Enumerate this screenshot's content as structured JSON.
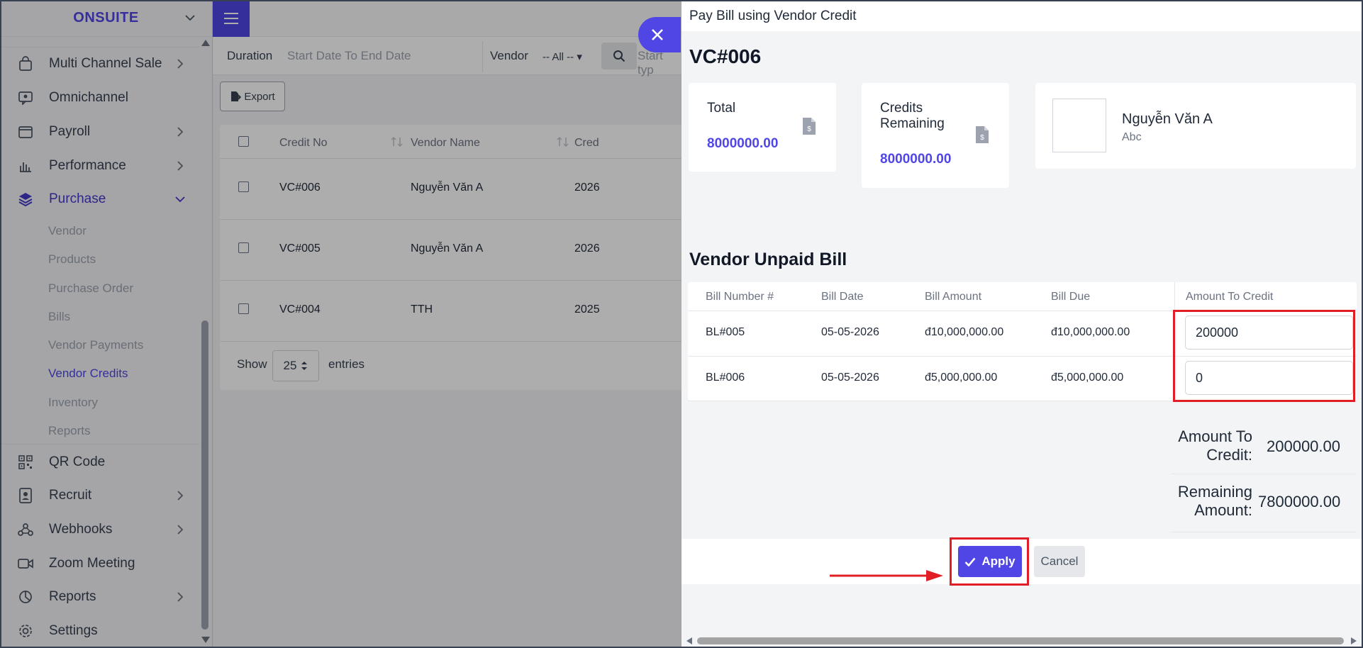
{
  "sidebar": {
    "brand": "ONSUITE",
    "items": [
      {
        "label": "Multi Channel Sale",
        "icon": "shopping-bag-icon"
      },
      {
        "label": "Omnichannel",
        "icon": "chat-icon"
      },
      {
        "label": "Payroll",
        "icon": "wallet-icon"
      },
      {
        "label": "Performance",
        "icon": "bar-chart-icon"
      },
      {
        "label": "Purchase",
        "icon": "layers-icon"
      },
      {
        "label": "QR Code",
        "icon": "qr-code-icon"
      },
      {
        "label": "Recruit",
        "icon": "id-badge-icon"
      },
      {
        "label": "Webhooks",
        "icon": "webhook-icon"
      },
      {
        "label": "Zoom Meeting",
        "icon": "video-icon"
      },
      {
        "label": "Reports",
        "icon": "pie-chart-icon"
      },
      {
        "label": "Settings",
        "icon": "gear-icon"
      }
    ],
    "purchase_sub": [
      "Vendor",
      "Products",
      "Purchase Order",
      "Bills",
      "Vendor Payments",
      "Vendor Credits",
      "Inventory",
      "Reports"
    ],
    "active_sub": "Vendor Credits"
  },
  "filters": {
    "duration_label": "Duration",
    "duration_value": "Start Date To End Date",
    "vendor_label": "Vendor",
    "vendor_value": "-- All --",
    "search_placeholder": "Start typ"
  },
  "toolbar": {
    "export_label": "Export"
  },
  "credits_table": {
    "headers": [
      "Credit No",
      "Vendor Name",
      "Cred"
    ],
    "rows": [
      {
        "credit_no": "VC#006",
        "vendor": "Nguyễn Văn A",
        "date": "2026"
      },
      {
        "credit_no": "VC#005",
        "vendor": "Nguyễn Văn A",
        "date": "2026"
      },
      {
        "credit_no": "VC#004",
        "vendor": "TTH",
        "date": "2025"
      }
    ],
    "show_label": "Show",
    "page_size": "25",
    "entries_label": "entries"
  },
  "drawer": {
    "title": "Pay Bill using Vendor Credit",
    "credit_no": "VC#006",
    "total_label": "Total",
    "total_value": "8000000.00",
    "credits_remaining_label_1": "Credits",
    "credits_remaining_label_2": "Remaining",
    "credits_remaining_value": "8000000.00",
    "vendor_name": "Nguyễn Văn A",
    "vendor_company": "Abc",
    "section_title": "Vendor Unpaid Bill",
    "bill_headers": [
      "Bill Number #",
      "Bill Date",
      "Bill Amount",
      "Bill Due",
      "Amount To Credit"
    ],
    "bills": [
      {
        "number": "BL#005",
        "date": "05-05-2026",
        "amount": "đ10,000,000.00",
        "due": "đ10,000,000.00",
        "credit": "200000"
      },
      {
        "number": "BL#006",
        "date": "05-05-2026",
        "amount": "đ5,000,000.00",
        "due": "đ5,000,000.00",
        "credit": "0"
      }
    ],
    "amount_to_credit_label_1": "Amount To",
    "amount_to_credit_label_2": "Credit:",
    "amount_to_credit_value": "200000.00",
    "remaining_label_1": "Remaining",
    "remaining_label_2": "Amount:",
    "remaining_value": "7800000.00",
    "apply_label": "Apply",
    "cancel_label": "Cancel"
  },
  "colors": {
    "accent": "#4f46e5",
    "highlight": "#e11d26"
  }
}
